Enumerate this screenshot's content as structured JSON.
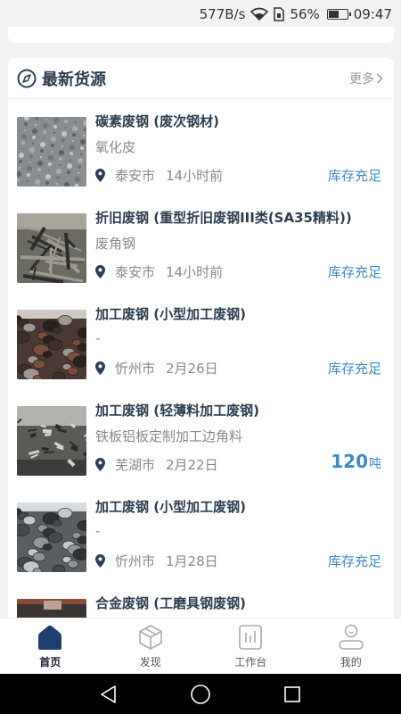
{
  "status_bar": {
    "speed": "577B/s",
    "battery_pct": "56%",
    "battery_level": 0.56,
    "time": "09:47"
  },
  "section": {
    "title": "最新货源",
    "more_label": "更多"
  },
  "items": [
    {
      "title": "碳素废钢 (废次钢材)",
      "subtitle": "氧化皮",
      "city": "泰安市",
      "time": "14小时前",
      "status": "库存充足",
      "thumb": "gravel"
    },
    {
      "title": "折旧废钢 (重型折旧废钢III类(SA35精料))",
      "subtitle": "废角钢",
      "city": "泰安市",
      "time": "14小时前",
      "status": "库存充足",
      "thumb": "scrap"
    },
    {
      "title": "加工废钢 (小型加工废钢)",
      "subtitle": "-",
      "city": "忻州市",
      "time": "2月26日",
      "status": "库存充足",
      "thumb": "discs"
    },
    {
      "title": "加工废钢 (轻薄料加工废钢)",
      "subtitle": "铁板铝板定制加工边角料",
      "city": "芜湖市",
      "time": "2月22日",
      "qty_num": "120",
      "qty_unit": "吨",
      "thumb": "pile"
    },
    {
      "title": "加工废钢 (小型加工废钢)",
      "subtitle": "-",
      "city": "忻州市",
      "time": "1月28日",
      "status": "库存充足",
      "thumb": "discs2"
    },
    {
      "title": "合金废钢 (工磨具钢废钢)",
      "subtitle": "",
      "city": "",
      "time": "",
      "status": "",
      "thumb": "dark"
    }
  ],
  "tabs": [
    {
      "label": "首页",
      "icon": "home-icon",
      "active": true
    },
    {
      "label": "发现",
      "icon": "cube-icon",
      "active": false
    },
    {
      "label": "工作台",
      "icon": "workbench-icon",
      "active": false
    },
    {
      "label": "我的",
      "icon": "profile-icon",
      "active": false
    }
  ],
  "colors": {
    "accent_blue": "#3a89c9",
    "title_navy": "#2c3e50",
    "tab_active": "#1f3f6e"
  }
}
